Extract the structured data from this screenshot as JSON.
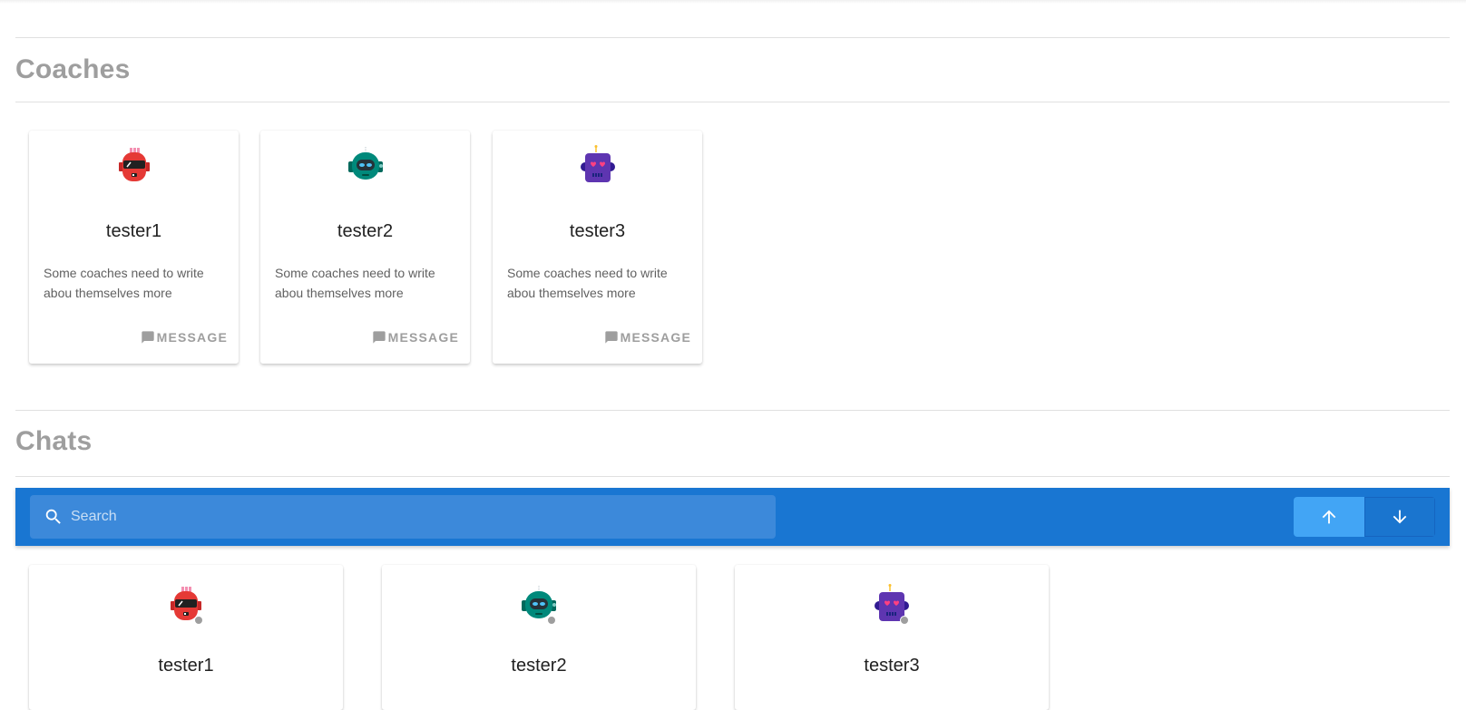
{
  "sections": {
    "coaches_title": "Coaches",
    "chats_title": "Chats"
  },
  "coaches": [
    {
      "name": "tester1",
      "bio": "Some coaches need to write abou themselves more",
      "avatar_icon": "red-robot-icon",
      "message_label": "MESSAGE"
    },
    {
      "name": "tester2",
      "bio": "Some coaches need to write abou themselves more",
      "avatar_icon": "teal-robot-icon",
      "message_label": "MESSAGE"
    },
    {
      "name": "tester3",
      "bio": "Some coaches need to write abou themselves more",
      "avatar_icon": "purple-robot-icon",
      "message_label": "MESSAGE"
    }
  ],
  "chat_toolbar": {
    "search_placeholder": "Search",
    "sort_buttons": [
      {
        "icon": "arrow-up-icon",
        "active": true
      },
      {
        "icon": "arrow-down-icon",
        "active": false
      }
    ]
  },
  "chats": [
    {
      "name": "tester1",
      "avatar_icon": "red-robot-icon",
      "status": "offline"
    },
    {
      "name": "tester2",
      "avatar_icon": "teal-robot-icon",
      "status": "offline"
    },
    {
      "name": "tester3",
      "avatar_icon": "purple-robot-icon",
      "status": "offline"
    }
  ],
  "colors": {
    "toolbar": "#1976d2",
    "search_bg": "#3c89da",
    "sort_active": "#42a5f5",
    "section_title": "#9e9e9e",
    "red_robot": "#e53935",
    "teal_robot": "#00897b",
    "purple_robot": "#5e35b1"
  }
}
